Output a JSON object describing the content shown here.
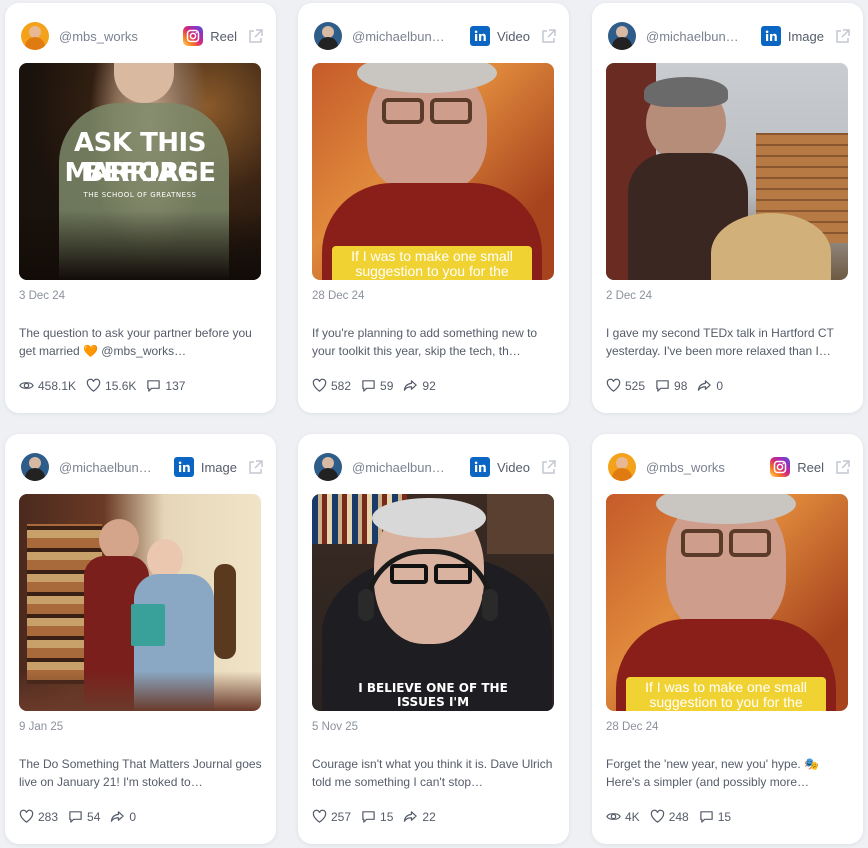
{
  "colors": {
    "instagram": "#d62976",
    "linkedin": "#0a66c2",
    "subtitle_yellow": "#f1d233"
  },
  "posts": [
    {
      "handle": "@mbs_works",
      "platform": "Reel",
      "platform_icon": "instagram-icon",
      "media_overlay": {
        "line1": "ASK THIS BEFORE",
        "line2": "MARRIAGE",
        "small": "THE SCHOOL OF GREATNESS"
      },
      "date": "3 Dec 24",
      "caption": "The question to ask your partner before you get married 🧡 @mbs_works…",
      "stats": [
        {
          "icon": "eye-icon",
          "value": "458.1K"
        },
        {
          "icon": "heart-icon",
          "value": "15.6K"
        },
        {
          "icon": "comment-icon",
          "value": "137"
        }
      ]
    },
    {
      "handle": "@michaelbun…",
      "platform": "Video",
      "platform_icon": "linkedin-icon",
      "media_subtitle": "If I was to make one small suggestion to you for the",
      "date": "28 Dec 24",
      "caption": "If you're planning to add something new to your toolkit this year, skip the tech, th…",
      "stats": [
        {
          "icon": "heart-icon",
          "value": "582"
        },
        {
          "icon": "comment-icon",
          "value": "59"
        },
        {
          "icon": "share-icon",
          "value": "92"
        }
      ]
    },
    {
      "handle": "@michaelbun…",
      "platform": "Image",
      "platform_icon": "linkedin-icon",
      "date": "2 Dec 24",
      "caption": "I gave my second TEDx talk in Hartford CT yesterday. I've been more relaxed than I…",
      "stats": [
        {
          "icon": "heart-icon",
          "value": "525"
        },
        {
          "icon": "comment-icon",
          "value": "98"
        },
        {
          "icon": "share-icon",
          "value": "0"
        }
      ]
    },
    {
      "handle": "@michaelbun…",
      "platform": "Image",
      "platform_icon": "linkedin-icon",
      "date": "9 Jan 25",
      "caption": "The Do Something That Matters Journal goes live on January 21! I'm stoked to…",
      "stats": [
        {
          "icon": "heart-icon",
          "value": "283"
        },
        {
          "icon": "comment-icon",
          "value": "54"
        },
        {
          "icon": "share-icon",
          "value": "0"
        }
      ]
    },
    {
      "handle": "@michaelbun…",
      "platform": "Video",
      "platform_icon": "linkedin-icon",
      "media_caption": "I BELIEVE ONE OF THE ISSUES I'M",
      "date": "5 Nov 25",
      "caption": "Courage isn't what you think it is. Dave Ulrich told me something I can't stop…",
      "stats": [
        {
          "icon": "heart-icon",
          "value": "257"
        },
        {
          "icon": "comment-icon",
          "value": "15"
        },
        {
          "icon": "share-icon",
          "value": "22"
        }
      ]
    },
    {
      "handle": "@mbs_works",
      "platform": "Reel",
      "platform_icon": "instagram-icon",
      "media_subtitle": "If I was to make one small suggestion to you for the",
      "date": "28 Dec 24",
      "caption": "Forget the 'new year, new you' hype. 🎭 Here's a simpler (and possibly more…",
      "stats": [
        {
          "icon": "eye-icon",
          "value": "4K"
        },
        {
          "icon": "heart-icon",
          "value": "248"
        },
        {
          "icon": "comment-icon",
          "value": "15"
        }
      ]
    }
  ]
}
